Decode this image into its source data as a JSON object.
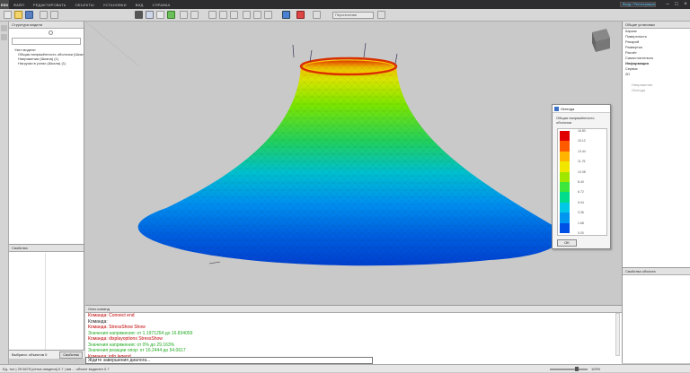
{
  "menu": {
    "logo": "ESS",
    "items": [
      "ФАЙЛ",
      "РЕДАКТИРОВАТЬ",
      "ОБЪЕКТЫ",
      "УСТАНОВКИ",
      "ВИД",
      "СПРАВКА"
    ],
    "search": "Вход / Регистрация"
  },
  "toolbar": {
    "view_select": "Перспектива"
  },
  "left_panel": {
    "title": "Структура модели",
    "tree": [
      "Узел модели",
      "Общая напряжённость оболочки (Шкала)",
      "Напряжения (Шкала) (1)",
      "Нагрузки в узлах (Шкала) (1)"
    ],
    "properties_title": "Свойства",
    "selection": "Выбрано: объектов 0",
    "select_button": "Свойства"
  },
  "right_panel": {
    "title": "Общие установки",
    "items": [
      "Каркас",
      "Поверхность",
      "Раскрой",
      "Развертка",
      "Расчёт",
      "Самостоятельно",
      "Информация",
      "Сервис",
      "2D"
    ],
    "sub_items": [
      "Напряжения",
      "Легенда"
    ],
    "lower_title": "Свойства объекта"
  },
  "legend": {
    "title": "Легенда",
    "subtitle": "Общая напряжённость оболочки",
    "values": [
      "16.80",
      "15.12",
      "13.44",
      "11.76",
      "10.08",
      "8.40",
      "6.72",
      "5.04",
      "3.36",
      "1.68",
      "0.00"
    ],
    "colors": [
      "#e10000",
      "#ff5a00",
      "#ffb400",
      "#f0e600",
      "#a0e600",
      "#3ce63c",
      "#00dc8c",
      "#00c8e6",
      "#0096f0",
      "#0050e6"
    ],
    "ok": "OK"
  },
  "command_panel": {
    "title": "Окно команд",
    "lines": [
      {
        "text": "Команда: Connect end",
        "color": "#c00000"
      },
      {
        "text": "Команда:",
        "color": "#222222"
      },
      {
        "text": "Команда: StressShow Show",
        "color": "#c00000"
      },
      {
        "text": "Значения напряжения: от 1.1971254 до 16.834059",
        "color": "#22aa22"
      },
      {
        "text": "Команда: displayoptions StressShow",
        "color": "#c00000"
      },
      {
        "text": "Значения напряжения: от 0% до 29.163%",
        "color": "#22aa22"
      },
      {
        "text": "Значения реакции опор: от 16.2444 до 54.0617",
        "color": "#22aa22"
      },
      {
        "text": "Команда: info legend",
        "color": "#c00000"
      }
    ],
    "input": "Ждите завершения диалога..."
  },
  "status_bar": {
    "text": "Ед. тон   |   29.5675 [сетка сведена] 0.7 | мм ... объект выделен 0.7",
    "zoom": "100%"
  }
}
